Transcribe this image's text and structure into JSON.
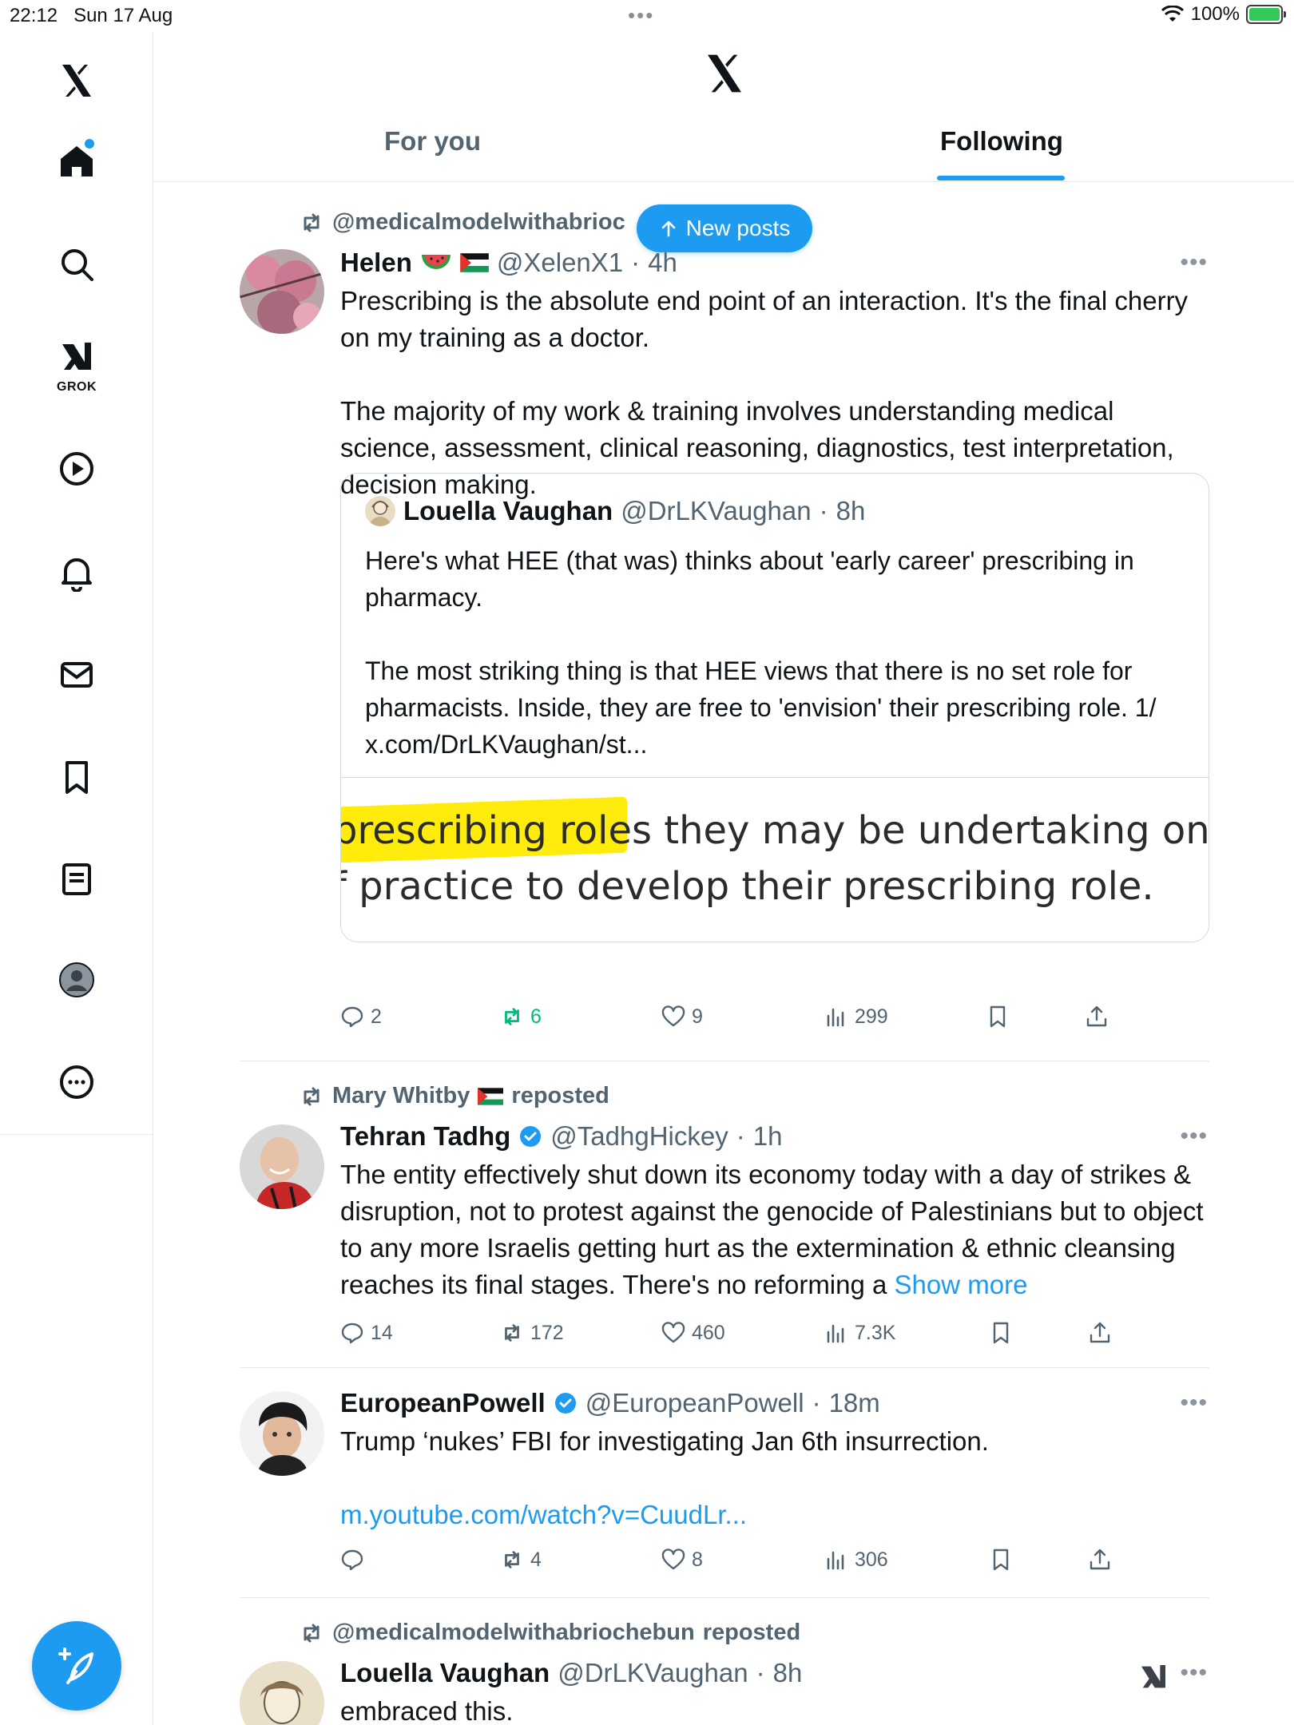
{
  "status_bar": {
    "time": "22:12",
    "date": "Sun 17 Aug",
    "battery": "100%"
  },
  "sidebar": {
    "grok_label": "GROK",
    "items": [
      "x-logo",
      "home",
      "search",
      "grok",
      "video",
      "notifications",
      "messages",
      "bookmarks",
      "lists",
      "profile",
      "more"
    ]
  },
  "header": {
    "tabs": [
      "For you",
      "Following"
    ],
    "active_tab": "Following"
  },
  "new_posts_label": "New posts",
  "posts": [
    {
      "repost_by": "@medicalmodelwithabrioc",
      "repost_suffix": "d",
      "name": "Helen",
      "handle": "@XelenX1",
      "time": "4h",
      "text": "Prescribing is the absolute end point of an interaction. It's the final cherry on my training as a doctor.\n\nThe majority of my work & training involves understanding medical science, assessment, clinical reasoning, diagnostics, test interpretation, decision making.",
      "quote": {
        "name": "Louella Vaughan",
        "handle": "@DrLKVaughan",
        "time": "8h",
        "text": "Here's what HEE (that was) thinks about 'early career' prescribing in pharmacy.\n\nThe most striking thing is that HEE views that there is no set role for pharmacists. Inside, they are free to 'envision' their prescribing role. 1/ x.com/DrLKVaughan/st...",
        "image_line1": "prescribing roles they may be undertaking once",
        "image_line2": "f practice to develop their prescribing role."
      },
      "stats": {
        "replies": "2",
        "reposts": "6",
        "likes": "9",
        "views": "299"
      }
    },
    {
      "repost_by": "Mary Whitby",
      "repost_suffix": "reposted",
      "name": "Tehran Tadhg",
      "handle": "@TadhgHickey",
      "time": "1h",
      "text": "The entity effectively shut down its economy today with a day of strikes & disruption, not to protest against the genocide of Palestinians but to object to any more Israelis getting hurt as the extermination & ethnic cleansing reaches its final stages. There's no reforming a ",
      "show_more": "Show more",
      "stats": {
        "replies": "14",
        "reposts": "172",
        "likes": "460",
        "views": "7.3K"
      }
    },
    {
      "name": "EuropeanPowell",
      "handle": "@EuropeanPowell",
      "time": "18m",
      "text": "Trump ‘nukes’ FBI for investigating Jan 6th insurrection.",
      "link": "m.youtube.com/watch?v=CuudLr...",
      "stats": {
        "replies": "",
        "reposts": "4",
        "likes": "8",
        "views": "306"
      }
    },
    {
      "repost_by": "@medicalmodelwithabriochebun",
      "repost_suffix": "reposted",
      "name": "Louella Vaughan",
      "handle": "@DrLKVaughan",
      "time": "8h",
      "text": "embraced this."
    }
  ],
  "colors": {
    "accent": "#1d9bf0",
    "repost_green": "#00ba7c",
    "muted": "#536471"
  }
}
